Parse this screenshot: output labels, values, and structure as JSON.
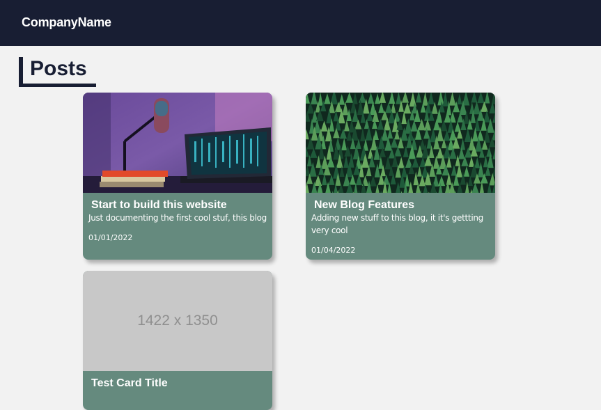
{
  "navbar": {
    "brand": "CompanyName"
  },
  "page": {
    "heading": "Posts"
  },
  "posts": [
    {
      "title": "Start to build this website",
      "text": "Just documenting the first cool stuf, this blog",
      "date": "01/01/2022",
      "image": "desk-laptop-microphone-photo"
    },
    {
      "title": "New Blog Features",
      "text": "Adding new stuff to this blog, it it's gettting very cool",
      "date": "01/04/2022",
      "image": "forest-aerial-photo"
    },
    {
      "title": "Test Card Title",
      "text": "",
      "date": "",
      "image": "placeholder-image",
      "image_placeholder_text": "1422 x 1350"
    }
  ],
  "colors": {
    "navbar": "#181e33",
    "card_body": "#658a7e",
    "page_background": "#f2f2f2"
  }
}
